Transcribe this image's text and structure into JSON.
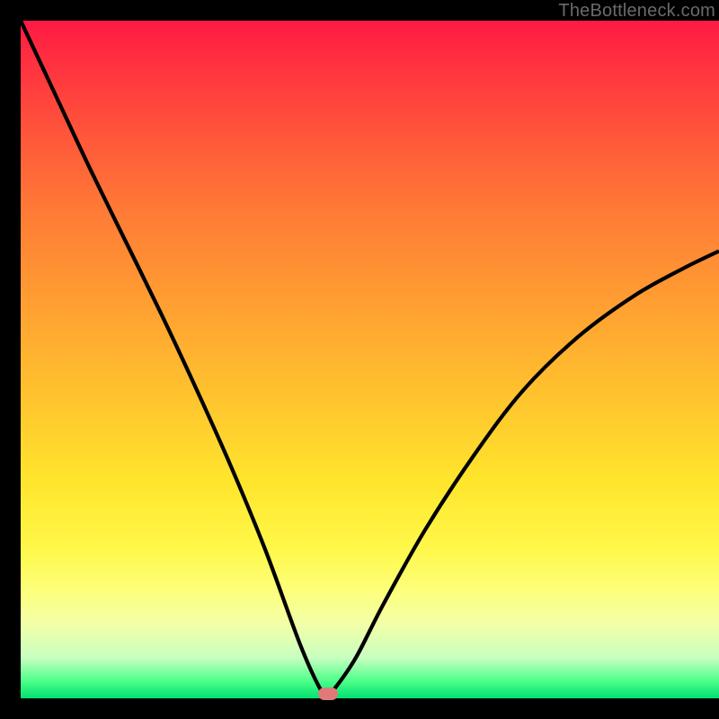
{
  "watermark": "TheBottleneck.com",
  "marker": {
    "x_pct": 44.0,
    "y_pct": 99.3
  },
  "colors": {
    "curve_stroke": "#000000",
    "marker_fill": "#e07a7a",
    "background_black": "#000000"
  },
  "chart_data": {
    "type": "line",
    "title": "",
    "xlabel": "",
    "ylabel": "",
    "xlim": [
      0,
      100
    ],
    "ylim": [
      0,
      100
    ],
    "series": [
      {
        "name": "bottleneck-curve",
        "x": [
          0,
          5,
          10,
          15,
          20,
          25,
          30,
          35,
          40,
          43,
          44,
          45,
          48,
          52,
          58,
          65,
          72,
          80,
          88,
          95,
          100
        ],
        "y": [
          100,
          89,
          78,
          67.5,
          57,
          46,
          34.5,
          22,
          8,
          1.2,
          0.7,
          1.5,
          6,
          14,
          25,
          36,
          45.5,
          53.5,
          59.5,
          63.5,
          66
        ]
      }
    ],
    "annotations": [
      {
        "type": "marker",
        "x": 44,
        "y": 0.7,
        "shape": "rounded-rect",
        "color": "#e07a7a"
      }
    ],
    "background": "heat-gradient-vertical"
  }
}
